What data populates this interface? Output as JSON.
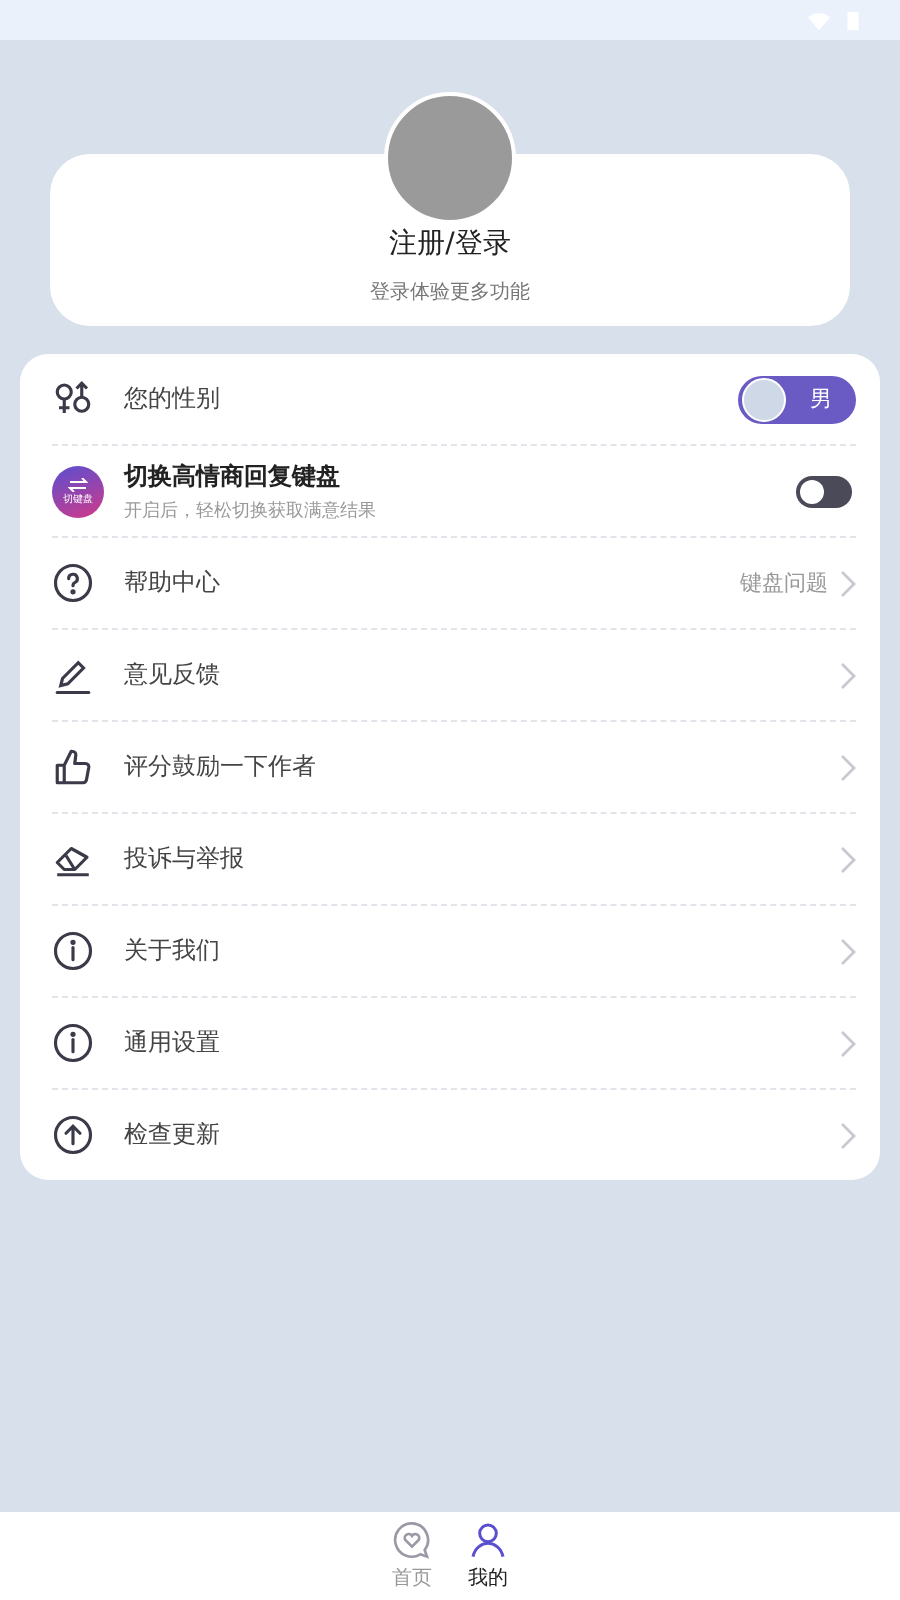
{
  "profile": {
    "title": "注册/登录",
    "subtitle": "登录体验更多功能"
  },
  "menu": [
    {
      "kind": "gender",
      "label": "您的性别",
      "value": "男"
    },
    {
      "kind": "toggle",
      "label": "切换高情商回复键盘",
      "badge": "切键盘",
      "description": "开启后，轻松切换获取满意结果",
      "on": false
    },
    {
      "kind": "link",
      "label": "帮助中心",
      "value": "键盘问题"
    },
    {
      "kind": "link",
      "label": "意见反馈"
    },
    {
      "kind": "link",
      "label": "评分鼓励一下作者"
    },
    {
      "kind": "link",
      "label": "投诉与举报"
    },
    {
      "kind": "link",
      "label": "关于我们"
    },
    {
      "kind": "link",
      "label": "通用设置"
    },
    {
      "kind": "link",
      "label": "检查更新"
    }
  ],
  "tabbar": [
    {
      "label": "首页",
      "selected": false
    },
    {
      "label": "我的",
      "selected": true
    }
  ]
}
